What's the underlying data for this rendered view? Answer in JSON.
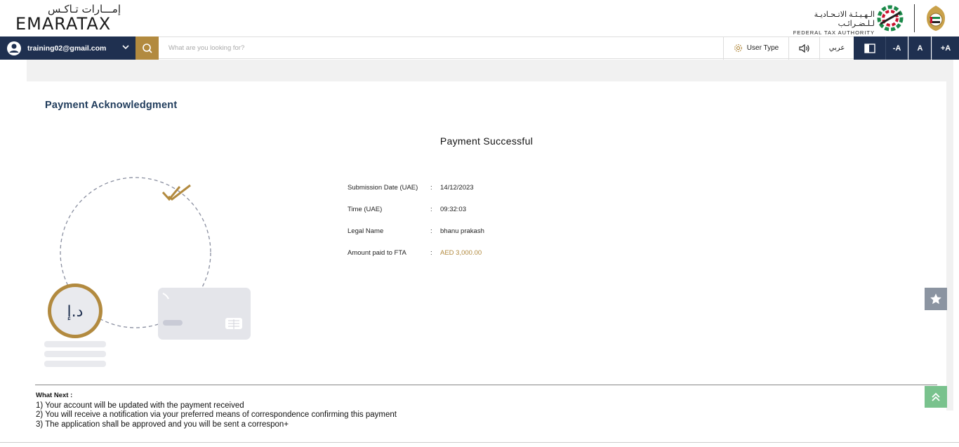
{
  "header": {
    "logo_ar": "إمـــارات تـاكـس",
    "logo_en": "EMARATAX",
    "fta_ar": "الـهـيـئـة الاتـحـاديـة لـلـضـرائـب",
    "fta_en": "FEDERAL TAX AUTHORITY"
  },
  "toolbar": {
    "user_email": "training02@gmail.com",
    "search_placeholder": "What are you looking for?",
    "user_type_label": "User Type",
    "language_label": "عربي",
    "font_decrease": "-A",
    "font_normal": "A",
    "font_increase": "+A"
  },
  "page": {
    "title": "Payment Acknowledgment",
    "status_title": "Payment Successful"
  },
  "illustration": {
    "currency_symbol": "د.إ"
  },
  "details": [
    {
      "label": "Submission Date (UAE)",
      "value": "14/12/2023"
    },
    {
      "label": "Time (UAE)",
      "value": "09:32:03"
    },
    {
      "label": "Legal Name",
      "value": "bhanu prakash"
    },
    {
      "label": "Amount paid to FTA",
      "value": "AED 3,000.00"
    }
  ],
  "next": {
    "title": "What Next :",
    "items": [
      "1) Your account will be updated with the payment received",
      "2) You will receive a notification via your preferred means of correspondence confirming this payment",
      "3) The application shall be approved and you will be sent a correspon+"
    ]
  },
  "colors": {
    "navy": "#1f3050",
    "gold": "#b28a3f",
    "title_blue": "#1f3b5b"
  }
}
